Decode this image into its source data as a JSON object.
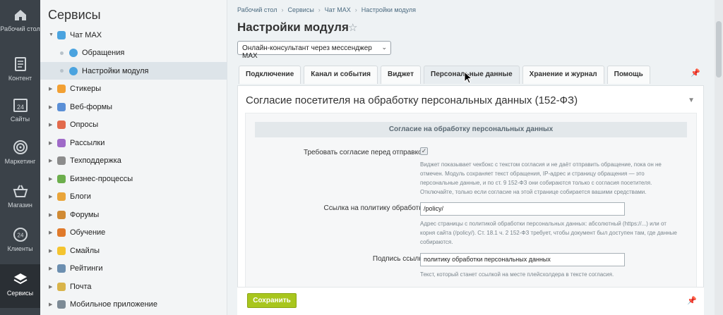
{
  "rail": [
    {
      "label": "Рабочий стол",
      "icon": "home-icon"
    },
    {
      "label": "Контент",
      "icon": "document-icon"
    },
    {
      "label": "Сайты",
      "icon": "calendar-icon",
      "badge": "24"
    },
    {
      "label": "Маркетинг",
      "icon": "target-icon"
    },
    {
      "label": "Магазин",
      "icon": "basket-icon"
    },
    {
      "label": "Клиенты",
      "icon": "clients-icon",
      "badge": "24"
    },
    {
      "label": "Сервисы",
      "icon": "layers-icon"
    }
  ],
  "sidebar": {
    "title": "Сервисы",
    "items": [
      {
        "label": "Чат MAX",
        "color": "#4aa3df",
        "open": true
      },
      {
        "label": "Обращения",
        "sub": true
      },
      {
        "label": "Настройки модуля",
        "sub": true,
        "active": true
      },
      {
        "label": "Стикеры",
        "color": "#f2a033"
      },
      {
        "label": "Веб-формы",
        "color": "#5a8fd6"
      },
      {
        "label": "Опросы",
        "color": "#e26a4c"
      },
      {
        "label": "Рассылки",
        "color": "#9f6ac8"
      },
      {
        "label": "Техподдержка",
        "color": "#8c8c8c"
      },
      {
        "label": "Бизнес-процессы",
        "color": "#6cae4c"
      },
      {
        "label": "Блоги",
        "color": "#e9a53a"
      },
      {
        "label": "Форумы",
        "color": "#d08a34"
      },
      {
        "label": "Обучение",
        "color": "#e07a2b"
      },
      {
        "label": "Смайлы",
        "color": "#f4c430"
      },
      {
        "label": "Рейтинги",
        "color": "#6c8fb0"
      },
      {
        "label": "Почта",
        "color": "#d9b44a"
      },
      {
        "label": "Мобильное приложение",
        "color": "#7d8b96"
      }
    ]
  },
  "breadcrumbs": [
    "Рабочий стол",
    "Сервисы",
    "Чат MAX",
    "Настройки модуля"
  ],
  "page_title": "Настройки модуля",
  "module_select": "Онлайн-консультант через мессенджер MAX",
  "tabs": [
    "Подключение",
    "Канал и события",
    "Виджет",
    "Персональные данные",
    "Хранение и журнал",
    "Помощь"
  ],
  "active_tab": 3,
  "panel": {
    "heading": "Согласие посетителя на обработку персональных данных (152-ФЗ)",
    "section": "Согласие на обработку персональных данных",
    "fields": {
      "require_label": "Требовать согласие перед отправкой:",
      "require_hint": "Виджет показывает чекбокс с текстом согласия и не даёт отправить обращение, пока он не отмечен. Модуль сохраняет текст обращения, IP-адрес и страницу обращения — это персональные данные, и по ст. 9 152-ФЗ они собираются только с согласия посетителя. Отключайте, только если согласие на этой странице собирается вашими средствами.",
      "policy_label": "Ссылка на политику обработки:",
      "policy_value": "/policy/",
      "policy_hint": "Адрес страницы с политикой обработки персональных данных: абсолютный (https://...) или от корня сайта (/policy/). Ст. 18.1 ч. 2 152-ФЗ требует, чтобы документ был доступен там, где данные собираются.",
      "link_label": "Подпись ссылки:",
      "link_value": "политику обработки персональных данных",
      "link_hint": "Текст, который станет ссылкой на месте плейсхолдера в тексте согласия."
    }
  },
  "save_label": "Сохранить",
  "checked_mark": "✓"
}
